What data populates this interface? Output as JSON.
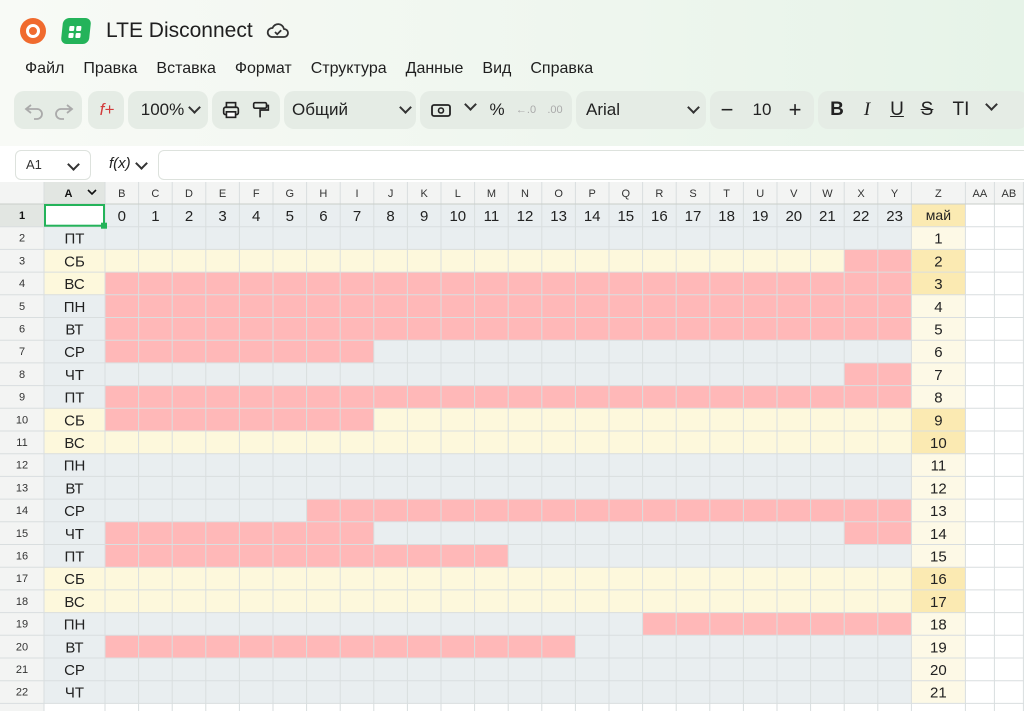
{
  "app": {
    "title": "LTE Disconnect"
  },
  "menu": [
    "Файл",
    "Правка",
    "Вставка",
    "Формат",
    "Структура",
    "Данные",
    "Вид",
    "Справка"
  ],
  "toolbar": {
    "zoom": "100%",
    "number_format": "Общий",
    "font_name": "Arial",
    "font_size": "10",
    "percent": "%",
    "bold": "B",
    "italic": "I",
    "underline": "U",
    "strike": "S"
  },
  "formula_bar": {
    "cell_ref": "A1",
    "fx_label": "f(x)",
    "value": ""
  },
  "sheet": {
    "column_letters": [
      "A",
      "B",
      "C",
      "D",
      "E",
      "F",
      "G",
      "H",
      "I",
      "J",
      "K",
      "L",
      "M",
      "N",
      "O",
      "P",
      "Q",
      "R",
      "S",
      "T",
      "U",
      "V",
      "W",
      "X",
      "Y",
      "Z",
      "AA",
      "AB"
    ],
    "hour_headers": [
      "0",
      "1",
      "2",
      "3",
      "4",
      "5",
      "6",
      "7",
      "8",
      "9",
      "10",
      "11",
      "12",
      "13",
      "14",
      "15",
      "16",
      "17",
      "18",
      "19",
      "20",
      "21",
      "22",
      "23"
    ],
    "month_header": "май",
    "active_cell": "A1",
    "rows": [
      {
        "n": "2",
        "day": "ПТ",
        "date": "1",
        "weekend": false,
        "disconnected": []
      },
      {
        "n": "3",
        "day": "СБ",
        "date": "2",
        "weekend": true,
        "disconnected": [
          22,
          23
        ]
      },
      {
        "n": "4",
        "day": "ВС",
        "date": "3",
        "weekend": true,
        "disconnected": [
          0,
          1,
          2,
          3,
          4,
          5,
          6,
          7,
          8,
          9,
          10,
          11,
          12,
          13,
          14,
          15,
          16,
          17,
          18,
          19,
          20,
          21,
          22,
          23
        ]
      },
      {
        "n": "5",
        "day": "ПН",
        "date": "4",
        "weekend": false,
        "disconnected": [
          0,
          1,
          2,
          3,
          4,
          5,
          6,
          7,
          8,
          9,
          10,
          11,
          12,
          13,
          14,
          15,
          16,
          17,
          18,
          19,
          20,
          21,
          22,
          23
        ]
      },
      {
        "n": "6",
        "day": "ВТ",
        "date": "5",
        "weekend": false,
        "disconnected": [
          0,
          1,
          2,
          3,
          4,
          5,
          6,
          7,
          8,
          9,
          10,
          11,
          12,
          13,
          14,
          15,
          16,
          17,
          18,
          19,
          20,
          21,
          22,
          23
        ]
      },
      {
        "n": "7",
        "day": "СР",
        "date": "6",
        "weekend": false,
        "disconnected": [
          0,
          1,
          2,
          3,
          4,
          5,
          6,
          7
        ]
      },
      {
        "n": "8",
        "day": "ЧТ",
        "date": "7",
        "weekend": false,
        "disconnected": [
          22,
          23
        ]
      },
      {
        "n": "9",
        "day": "ПТ",
        "date": "8",
        "weekend": false,
        "disconnected": [
          0,
          1,
          2,
          3,
          4,
          5,
          6,
          7,
          8,
          9,
          10,
          11,
          12,
          13,
          14,
          15,
          16,
          17,
          18,
          19,
          20,
          21,
          22,
          23
        ]
      },
      {
        "n": "10",
        "day": "СБ",
        "date": "9",
        "weekend": true,
        "disconnected": [
          0,
          1,
          2,
          3,
          4,
          5,
          6,
          7
        ]
      },
      {
        "n": "11",
        "day": "ВС",
        "date": "10",
        "weekend": true,
        "disconnected": []
      },
      {
        "n": "12",
        "day": "ПН",
        "date": "11",
        "weekend": false,
        "disconnected": []
      },
      {
        "n": "13",
        "day": "ВТ",
        "date": "12",
        "weekend": false,
        "disconnected": []
      },
      {
        "n": "14",
        "day": "СР",
        "date": "13",
        "weekend": false,
        "disconnected": [
          6,
          7,
          8,
          9,
          10,
          11,
          12,
          13,
          14,
          15,
          16,
          17,
          18,
          19,
          20,
          21,
          22,
          23
        ]
      },
      {
        "n": "15",
        "day": "ЧТ",
        "date": "14",
        "weekend": false,
        "disconnected": [
          0,
          1,
          2,
          3,
          4,
          5,
          6,
          7,
          22,
          23
        ]
      },
      {
        "n": "16",
        "day": "ПТ",
        "date": "15",
        "weekend": false,
        "disconnected": [
          0,
          1,
          2,
          3,
          4,
          5,
          6,
          7,
          8,
          9,
          10,
          11
        ]
      },
      {
        "n": "17",
        "day": "СБ",
        "date": "16",
        "weekend": true,
        "disconnected": []
      },
      {
        "n": "18",
        "day": "ВС",
        "date": "17",
        "weekend": true,
        "disconnected": []
      },
      {
        "n": "19",
        "day": "ПН",
        "date": "18",
        "weekend": false,
        "disconnected": [
          16,
          17,
          18,
          19,
          20,
          21,
          22,
          23
        ]
      },
      {
        "n": "20",
        "day": "ВТ",
        "date": "19",
        "weekend": false,
        "disconnected": [
          0,
          1,
          2,
          3,
          4,
          5,
          6,
          7,
          8,
          9,
          10,
          11,
          12,
          13
        ]
      },
      {
        "n": "21",
        "day": "СР",
        "date": "20",
        "weekend": false,
        "disconnected": []
      },
      {
        "n": "22",
        "day": "ЧТ",
        "date": "21",
        "weekend": false,
        "disconnected": []
      }
    ]
  },
  "colors": {
    "disconnected": "#ffb8b8",
    "weekday": "#e9eef0",
    "weekend": "#fdf8dc",
    "date_weekday": "#fdf9e6",
    "date_weekend": "#fbeab2",
    "header_bg": "#f3f4f3",
    "gridline": "#d9dedf",
    "accent": "#24b35a"
  }
}
